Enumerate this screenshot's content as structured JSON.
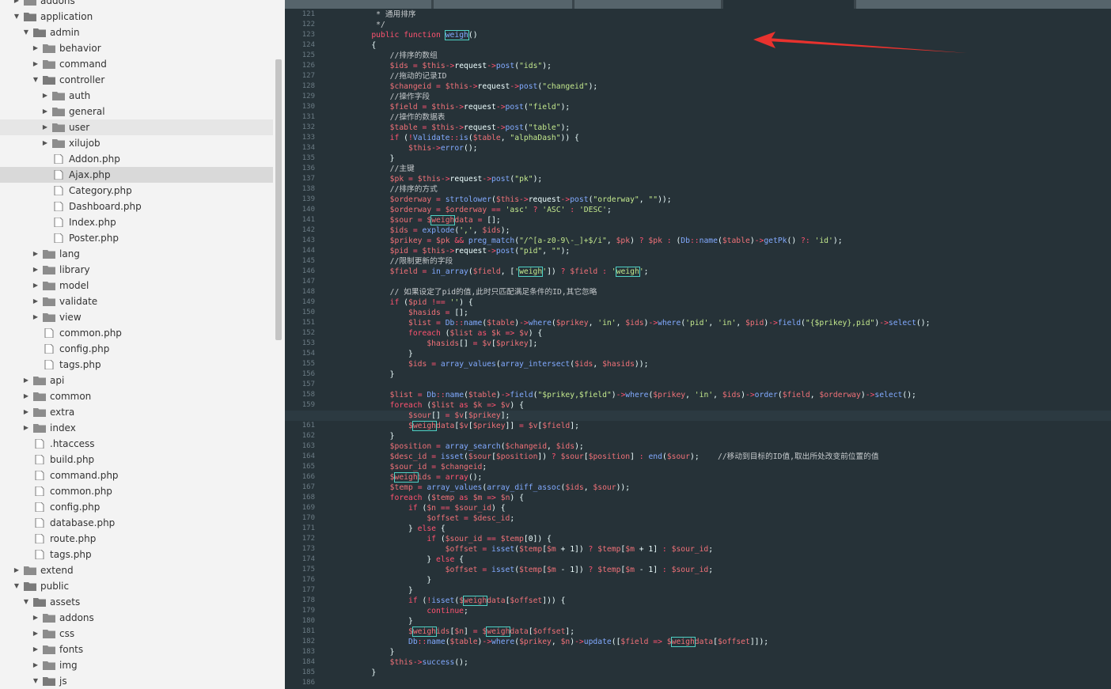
{
  "sidebar": {
    "items": [
      {
        "label": "addons",
        "indent": 0,
        "type": "folder",
        "state": "collapsed"
      },
      {
        "label": "application",
        "indent": 0,
        "type": "folder",
        "state": "expanded"
      },
      {
        "label": "admin",
        "indent": 1,
        "type": "folder",
        "state": "expanded"
      },
      {
        "label": "behavior",
        "indent": 2,
        "type": "folder",
        "state": "collapsed"
      },
      {
        "label": "command",
        "indent": 2,
        "type": "folder",
        "state": "collapsed"
      },
      {
        "label": "controller",
        "indent": 2,
        "type": "folder",
        "state": "expanded"
      },
      {
        "label": "auth",
        "indent": 3,
        "type": "folder",
        "state": "collapsed"
      },
      {
        "label": "general",
        "indent": 3,
        "type": "folder",
        "state": "collapsed"
      },
      {
        "label": "user",
        "indent": 3,
        "type": "folder",
        "state": "collapsed",
        "hover": true
      },
      {
        "label": "xilujob",
        "indent": 3,
        "type": "folder",
        "state": "collapsed"
      },
      {
        "label": "Addon.php",
        "indent": 3,
        "type": "file"
      },
      {
        "label": "Ajax.php",
        "indent": 3,
        "type": "file",
        "selected": true
      },
      {
        "label": "Category.php",
        "indent": 3,
        "type": "file"
      },
      {
        "label": "Dashboard.php",
        "indent": 3,
        "type": "file"
      },
      {
        "label": "Index.php",
        "indent": 3,
        "type": "file"
      },
      {
        "label": "Poster.php",
        "indent": 3,
        "type": "file"
      },
      {
        "label": "lang",
        "indent": 2,
        "type": "folder",
        "state": "collapsed"
      },
      {
        "label": "library",
        "indent": 2,
        "type": "folder",
        "state": "collapsed"
      },
      {
        "label": "model",
        "indent": 2,
        "type": "folder",
        "state": "collapsed"
      },
      {
        "label": "validate",
        "indent": 2,
        "type": "folder",
        "state": "collapsed"
      },
      {
        "label": "view",
        "indent": 2,
        "type": "folder",
        "state": "collapsed"
      },
      {
        "label": "common.php",
        "indent": 2,
        "type": "file"
      },
      {
        "label": "config.php",
        "indent": 2,
        "type": "file"
      },
      {
        "label": "tags.php",
        "indent": 2,
        "type": "file"
      },
      {
        "label": "api",
        "indent": 1,
        "type": "folder",
        "state": "collapsed"
      },
      {
        "label": "common",
        "indent": 1,
        "type": "folder",
        "state": "collapsed"
      },
      {
        "label": "extra",
        "indent": 1,
        "type": "folder",
        "state": "collapsed"
      },
      {
        "label": "index",
        "indent": 1,
        "type": "folder",
        "state": "collapsed"
      },
      {
        "label": ".htaccess",
        "indent": 1,
        "type": "file"
      },
      {
        "label": "build.php",
        "indent": 1,
        "type": "file"
      },
      {
        "label": "command.php",
        "indent": 1,
        "type": "file"
      },
      {
        "label": "common.php",
        "indent": 1,
        "type": "file"
      },
      {
        "label": "config.php",
        "indent": 1,
        "type": "file"
      },
      {
        "label": "database.php",
        "indent": 1,
        "type": "file"
      },
      {
        "label": "route.php",
        "indent": 1,
        "type": "file"
      },
      {
        "label": "tags.php",
        "indent": 1,
        "type": "file"
      },
      {
        "label": "extend",
        "indent": 0,
        "type": "folder",
        "state": "collapsed"
      },
      {
        "label": "public",
        "indent": 0,
        "type": "folder",
        "state": "expanded"
      },
      {
        "label": "assets",
        "indent": 1,
        "type": "folder",
        "state": "expanded"
      },
      {
        "label": "addons",
        "indent": 2,
        "type": "folder",
        "state": "collapsed"
      },
      {
        "label": "css",
        "indent": 2,
        "type": "folder",
        "state": "collapsed"
      },
      {
        "label": "fonts",
        "indent": 2,
        "type": "folder",
        "state": "collapsed"
      },
      {
        "label": "img",
        "indent": 2,
        "type": "folder",
        "state": "collapsed"
      },
      {
        "label": "js",
        "indent": 2,
        "type": "folder",
        "state": "expanded"
      }
    ]
  },
  "editor": {
    "current_line": 160,
    "highlight_word": "weigh",
    "colors": {
      "background": "#263238",
      "keyword": "#ff5370",
      "function": "#82aaff",
      "string": "#c3e88d",
      "variable": "#f07178",
      "comment": "#c5c9cc",
      "text": "#eeffff",
      "match_outline": "#4fd1c5",
      "annotation_arrow": "#e8322e"
    },
    "lines": [
      {
        "n": "121",
        "code": "     * 通用排序"
      },
      {
        "n": "122",
        "code": "     */"
      },
      {
        "n": "123",
        "code": "    public function weigh()"
      },
      {
        "n": "124",
        "code": "    {"
      },
      {
        "n": "125",
        "code": "        //排序的数组"
      },
      {
        "n": "126",
        "code": "        $ids = $this->request->post(\"ids\");"
      },
      {
        "n": "127",
        "code": "        //拖动的记录ID"
      },
      {
        "n": "128",
        "code": "        $changeid = $this->request->post(\"changeid\");"
      },
      {
        "n": "129",
        "code": "        //操作字段"
      },
      {
        "n": "130",
        "code": "        $field = $this->request->post(\"field\");"
      },
      {
        "n": "131",
        "code": "        //操作的数据表"
      },
      {
        "n": "132",
        "code": "        $table = $this->request->post(\"table\");"
      },
      {
        "n": "133",
        "code": "        if (!Validate::is($table, \"alphaDash\")) {"
      },
      {
        "n": "134",
        "code": "            $this->error();"
      },
      {
        "n": "135",
        "code": "        }"
      },
      {
        "n": "136",
        "code": "        //主键"
      },
      {
        "n": "137",
        "code": "        $pk = $this->request->post(\"pk\");"
      },
      {
        "n": "138",
        "code": "        //排序的方式"
      },
      {
        "n": "139",
        "code": "        $orderway = strtolower($this->request->post(\"orderway\", \"\"));"
      },
      {
        "n": "140",
        "code": "        $orderway = $orderway == 'asc' ? 'ASC' : 'DESC';"
      },
      {
        "n": "141",
        "code": "        $sour = $weighdata = [];"
      },
      {
        "n": "142",
        "code": "        $ids = explode(',', $ids);"
      },
      {
        "n": "143",
        "code": "        $prikey = $pk && preg_match(\"/^[a-z0-9\\-_]+$/i\", $pk) ? $pk : (Db::name($table)->getPk() ?: 'id');"
      },
      {
        "n": "144",
        "code": "        $pid = $this->request->post(\"pid\", \"\");"
      },
      {
        "n": "145",
        "code": "        //限制更新的字段"
      },
      {
        "n": "146",
        "code": "        $field = in_array($field, ['weigh']) ? $field : 'weigh';"
      },
      {
        "n": "147",
        "code": ""
      },
      {
        "n": "148",
        "code": "        // 如果设定了pid的值,此时只匹配满足条件的ID,其它忽略"
      },
      {
        "n": "149",
        "code": "        if ($pid !== '') {"
      },
      {
        "n": "150",
        "code": "            $hasids = [];"
      },
      {
        "n": "151",
        "code": "            $list = Db::name($table)->where($prikey, 'in', $ids)->where('pid', 'in', $pid)->field(\"{$prikey},pid\")->select();"
      },
      {
        "n": "152",
        "code": "            foreach ($list as $k => $v) {"
      },
      {
        "n": "153",
        "code": "                $hasids[] = $v[$prikey];"
      },
      {
        "n": "154",
        "code": "            }"
      },
      {
        "n": "155",
        "code": "            $ids = array_values(array_intersect($ids, $hasids));"
      },
      {
        "n": "156",
        "code": "        }"
      },
      {
        "n": "157",
        "code": ""
      },
      {
        "n": "158",
        "code": "        $list = Db::name($table)->field(\"$prikey,$field\")->where($prikey, 'in', $ids)->order($field, $orderway)->select();"
      },
      {
        "n": "159",
        "code": "        foreach ($list as $k => $v) {"
      },
      {
        "n": "160",
        "code": "            $sour[] = $v[$prikey];"
      },
      {
        "n": "161",
        "code": "            $weighdata[$v[$prikey]] = $v[$field];"
      },
      {
        "n": "162",
        "code": "        }"
      },
      {
        "n": "163",
        "code": "        $position = array_search($changeid, $ids);"
      },
      {
        "n": "164",
        "code": "        $desc_id = isset($sour[$position]) ? $sour[$position] : end($sour);    //移动到目标的ID值,取出所处改变前位置的值"
      },
      {
        "n": "165",
        "code": "        $sour_id = $changeid;"
      },
      {
        "n": "166",
        "code": "        $weighids = array();"
      },
      {
        "n": "167",
        "code": "        $temp = array_values(array_diff_assoc($ids, $sour));"
      },
      {
        "n": "168",
        "code": "        foreach ($temp as $m => $n) {"
      },
      {
        "n": "169",
        "code": "            if ($n == $sour_id) {"
      },
      {
        "n": "170",
        "code": "                $offset = $desc_id;"
      },
      {
        "n": "171",
        "code": "            } else {"
      },
      {
        "n": "172",
        "code": "                if ($sour_id == $temp[0]) {"
      },
      {
        "n": "173",
        "code": "                    $offset = isset($temp[$m + 1]) ? $temp[$m + 1] : $sour_id;"
      },
      {
        "n": "174",
        "code": "                } else {"
      },
      {
        "n": "175",
        "code": "                    $offset = isset($temp[$m - 1]) ? $temp[$m - 1] : $sour_id;"
      },
      {
        "n": "176",
        "code": "                }"
      },
      {
        "n": "177",
        "code": "            }"
      },
      {
        "n": "178",
        "code": "            if (!isset($weighdata[$offset])) {"
      },
      {
        "n": "179",
        "code": "                continue;"
      },
      {
        "n": "180",
        "code": "            }"
      },
      {
        "n": "181",
        "code": "            $weighids[$n] = $weighdata[$offset];"
      },
      {
        "n": "182",
        "code": "            Db::name($table)->where($prikey, $n)->update([$field => $weighdata[$offset]]);"
      },
      {
        "n": "183",
        "code": "        }"
      },
      {
        "n": "184",
        "code": "        $this->success();"
      },
      {
        "n": "185",
        "code": "    }"
      },
      {
        "n": "186",
        "code": ""
      }
    ]
  }
}
